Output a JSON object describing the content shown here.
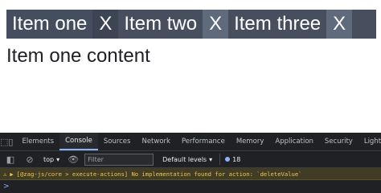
{
  "tabs": [
    {
      "label": "Item one",
      "close": "X"
    },
    {
      "label": "Item two",
      "close": "X"
    },
    {
      "label": "Item three",
      "close": "X"
    }
  ],
  "content": "Item one content",
  "devtools": {
    "tabs": [
      "Elements",
      "Console",
      "Sources",
      "Network",
      "Performance",
      "Memory",
      "Application",
      "Security",
      "Lighth"
    ],
    "active_tab": "Console",
    "context": "top",
    "filter_placeholder": "Filter",
    "levels": "Default levels",
    "issues_count": "18",
    "warning": "[@zag-js/core > execute-actions] No implementation found for action: `deleteValue`",
    "prompt": ">"
  },
  "colors": {
    "tab_bg": "#474f5f",
    "close_bg": "#5f6a7c",
    "devtools_bg": "#202124",
    "warning_bg": "#413c26"
  }
}
